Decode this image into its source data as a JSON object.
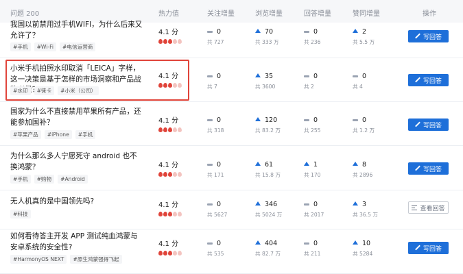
{
  "header": {
    "question": "问题 200",
    "heat": "热力值",
    "follow": "关注增量",
    "views": "浏览增量",
    "answers": "回答增量",
    "likes": "赞同增量",
    "actions": "操作"
  },
  "colors": {
    "primary": "#1e6fd9",
    "flame_on": "#e0443a",
    "flame_off": "#f3c4c0",
    "highlight": "#e0443a"
  },
  "rows": [
    {
      "title": "我国以前禁用过手机WIFI，为什么后来又允许了？",
      "tags": [
        "#手机",
        "#Wi-Fi",
        "#电信运营商"
      ],
      "heat": "4.1 分",
      "flames_filled": 3,
      "follow": {
        "trend": "flat",
        "value": "0",
        "total": "共 727"
      },
      "views": {
        "trend": "up",
        "value": "70",
        "total": "共 333 万"
      },
      "answers": {
        "trend": "flat",
        "value": "0",
        "total": "共 236"
      },
      "likes": {
        "trend": "up",
        "value": "2",
        "total": "共 5.5 万"
      },
      "action": "写回答",
      "action_type": "primary"
    },
    {
      "title": "小米手机拍照水印取消「LEICA」字样，这一决策是基于怎样的市场洞察和产品战略考量？",
      "tags": [
        "#水印",
        "#徕卡",
        "#小米（公司）"
      ],
      "heat": "4.1 分",
      "flames_filled": 3,
      "follow": {
        "trend": "flat",
        "value": "0",
        "total": "共 7"
      },
      "views": {
        "trend": "up",
        "value": "35",
        "total": "共 3600"
      },
      "answers": {
        "trend": "flat",
        "value": "0",
        "total": "共 2"
      },
      "likes": {
        "trend": "flat",
        "value": "0",
        "total": "共 4"
      },
      "action": "写回答",
      "action_type": "primary"
    },
    {
      "title": "国家为什么不直接禁用苹果所有产品，还能参加国补？",
      "tags": [
        "#苹果产品",
        "#iPhone",
        "#手机"
      ],
      "heat": "4.1 分",
      "flames_filled": 3,
      "follow": {
        "trend": "flat",
        "value": "0",
        "total": "共 318"
      },
      "views": {
        "trend": "up",
        "value": "120",
        "total": "共 83.2 万"
      },
      "answers": {
        "trend": "flat",
        "value": "0",
        "total": "共 255"
      },
      "likes": {
        "trend": "flat",
        "value": "0",
        "total": "共 1.2 万"
      },
      "action": "写回答",
      "action_type": "primary"
    },
    {
      "title": "为什么那么多人宁愿死守 android 也不换鸿蒙？",
      "tags": [
        "#手机",
        "#购物",
        "#Android"
      ],
      "heat": "4.1 分",
      "flames_filled": 3,
      "follow": {
        "trend": "flat",
        "value": "0",
        "total": "共 171"
      },
      "views": {
        "trend": "up",
        "value": "61",
        "total": "共 15.8 万"
      },
      "answers": {
        "trend": "up",
        "value": "1",
        "total": "共 170"
      },
      "likes": {
        "trend": "up",
        "value": "8",
        "total": "共 2896"
      },
      "action": "写回答",
      "action_type": "primary"
    },
    {
      "title": "无人机真的是中国领先吗?",
      "tags": [
        "#科技"
      ],
      "heat": "4.1 分",
      "flames_filled": 3,
      "follow": {
        "trend": "flat",
        "value": "0",
        "total": "共 5627"
      },
      "views": {
        "trend": "up",
        "value": "346",
        "total": "共 5024 万"
      },
      "answers": {
        "trend": "flat",
        "value": "0",
        "total": "共 2017"
      },
      "likes": {
        "trend": "up",
        "value": "3",
        "total": "共 36.5 万"
      },
      "action": "查看回答",
      "action_type": "outline"
    },
    {
      "title": "如何看待答主开发 APP 测试纯血鸿蒙与安卓系统的安全性?",
      "tags": [
        "#HarmonyOS NEXT",
        "#原生鸿蒙强得飞起"
      ],
      "heat": "4.1 分",
      "flames_filled": 3,
      "follow": {
        "trend": "flat",
        "value": "0",
        "total": "共 535"
      },
      "views": {
        "trend": "up",
        "value": "404",
        "total": "共 82.7 万"
      },
      "answers": {
        "trend": "flat",
        "value": "0",
        "total": "共 211"
      },
      "likes": {
        "trend": "up",
        "value": "10",
        "total": "共 5284"
      },
      "action": "写回答",
      "action_type": "primary"
    }
  ]
}
